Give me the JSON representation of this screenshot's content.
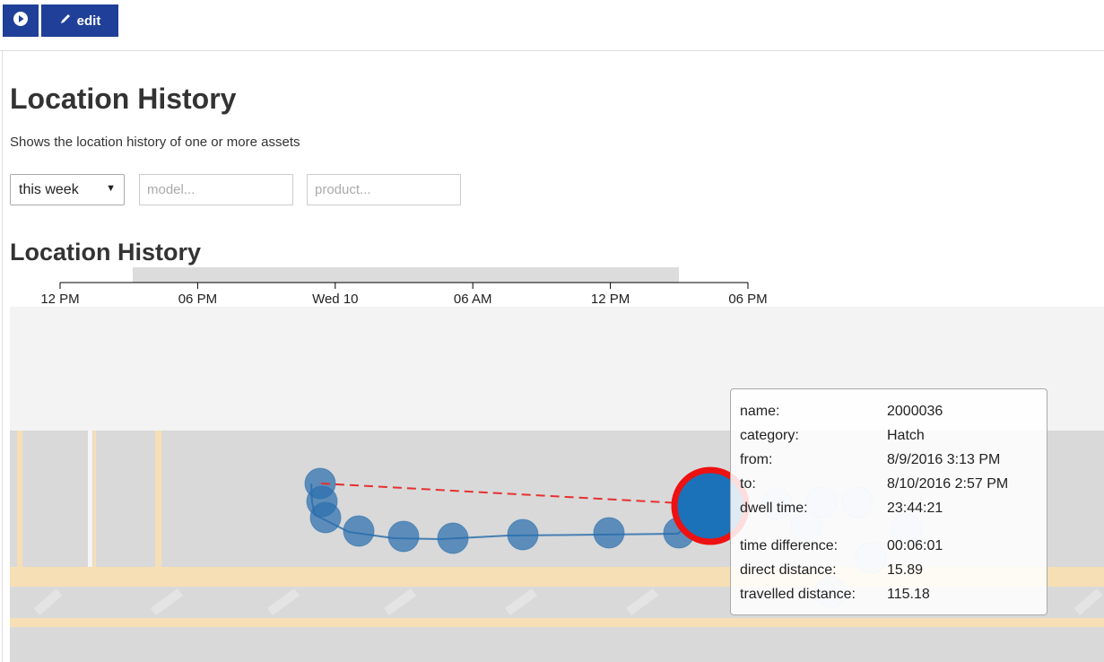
{
  "toolbar": {
    "play_icon": "play-circle-icon",
    "edit_icon": "pencil-icon",
    "edit_label": "edit"
  },
  "page": {
    "title": "Location History",
    "subtitle": "Shows the location history of one or more assets"
  },
  "filters": {
    "period": {
      "selected": "this week",
      "arrow": "▼"
    },
    "model": {
      "value": "",
      "placeholder": "model..."
    },
    "product": {
      "value": "",
      "placeholder": "product..."
    }
  },
  "section": {
    "title": "Location History"
  },
  "timeline": {
    "ticks": [
      "12 PM",
      "06 PM",
      "Wed 10",
      "06 AM",
      "12 PM",
      "06 PM"
    ]
  },
  "tooltip": {
    "rows": [
      {
        "label": "name:",
        "value": "2000036"
      },
      {
        "label": "category:",
        "value": "Hatch"
      },
      {
        "label": "from:",
        "value": "8/9/2016 3:13 PM"
      },
      {
        "label": "to:",
        "value": "8/10/2016 2:57 PM"
      },
      {
        "label": "dwell time:",
        "value": "23:44:21"
      },
      {
        "label": "time difference:",
        "value": "00:06:01"
      },
      {
        "label": "direct distance:",
        "value": "15.89"
      },
      {
        "label": "travelled distance:",
        "value": "115.18"
      }
    ]
  },
  "colors": {
    "brand": "#1f3f98",
    "point": "#2b6fad",
    "selected_point": "#1b72b8",
    "highlight_ring": "#ee1111",
    "direct_line": "#e63030",
    "stripe": "#f7dfb5"
  }
}
